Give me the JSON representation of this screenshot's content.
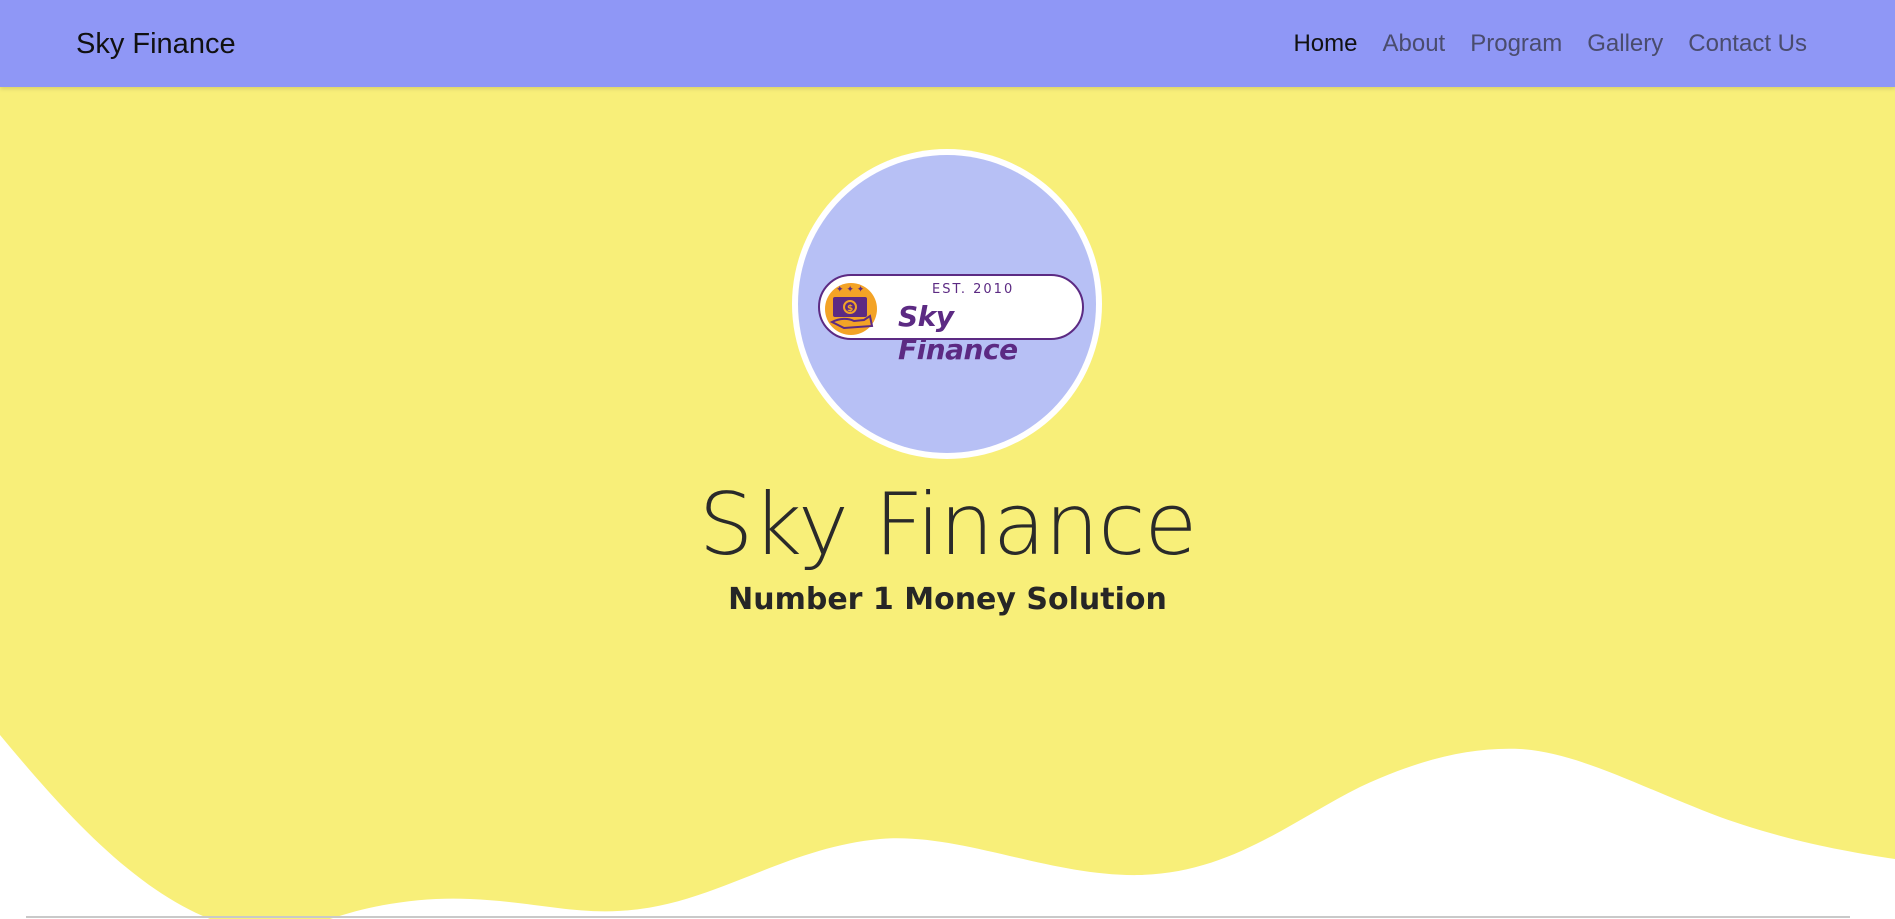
{
  "colors": {
    "navbar": "#8f97f6",
    "hero": "#f8ef79",
    "logo_circle": "#b7c0f5",
    "brand_purple": "#5c2a83",
    "brand_orange": "#f3a326"
  },
  "navbar": {
    "brand": "Sky Finance",
    "links": [
      {
        "label": "Home",
        "active": true
      },
      {
        "label": "About",
        "active": false
      },
      {
        "label": "Program",
        "active": false
      },
      {
        "label": "Gallery",
        "active": false
      },
      {
        "label": "Contact Us",
        "active": false
      }
    ]
  },
  "logo": {
    "established": "EST. 2010",
    "name": "Sky Finance",
    "icon": "money-hand-icon"
  },
  "hero": {
    "title": "Sky Finance",
    "subtitle": "Number 1 Money Solution"
  }
}
